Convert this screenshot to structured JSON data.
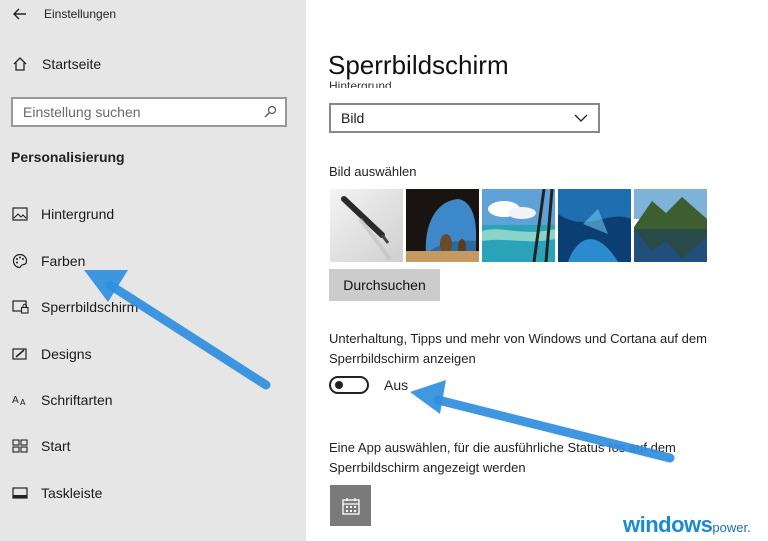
{
  "window": {
    "title": "Einstellungen"
  },
  "sidebar": {
    "home_label": "Startseite",
    "search_placeholder": "Einstellung suchen",
    "section_title": "Personalisierung",
    "items": [
      {
        "label": "Hintergrund",
        "icon": "picture-icon"
      },
      {
        "label": "Farben",
        "icon": "palette-icon"
      },
      {
        "label": "Sperrbildschirm",
        "icon": "lockscreen-icon"
      },
      {
        "label": "Designs",
        "icon": "brush-icon"
      },
      {
        "label": "Schriftarten",
        "icon": "font-icon"
      },
      {
        "label": "Start",
        "icon": "start-icon"
      },
      {
        "label": "Taskleiste",
        "icon": "taskbar-icon"
      }
    ]
  },
  "main": {
    "title": "Sperrbildschirm",
    "cut_label": "Hintergrund",
    "background_select": {
      "value": "Bild"
    },
    "choose_picture_label": "Bild auswählen",
    "browse_button": "Durchsuchen",
    "tips_description": "Unterhaltung, Tipps und mehr von Windows und Cortana auf dem Sperrbildschirm anzeigen",
    "toggle": {
      "state": "off",
      "label": "Aus"
    },
    "app_description": "Eine App auswählen, für die ausführliche Status fos auf dem Sperrbildschirm angezeigt werden",
    "app_icon": "calendar-icon"
  },
  "branding": {
    "text_main": "windows",
    "text_suffix": "power."
  },
  "colors": {
    "sidebar_bg": "#e6e6e6",
    "arrow": "#2f8fe0",
    "brand": "#1a8ad4"
  }
}
